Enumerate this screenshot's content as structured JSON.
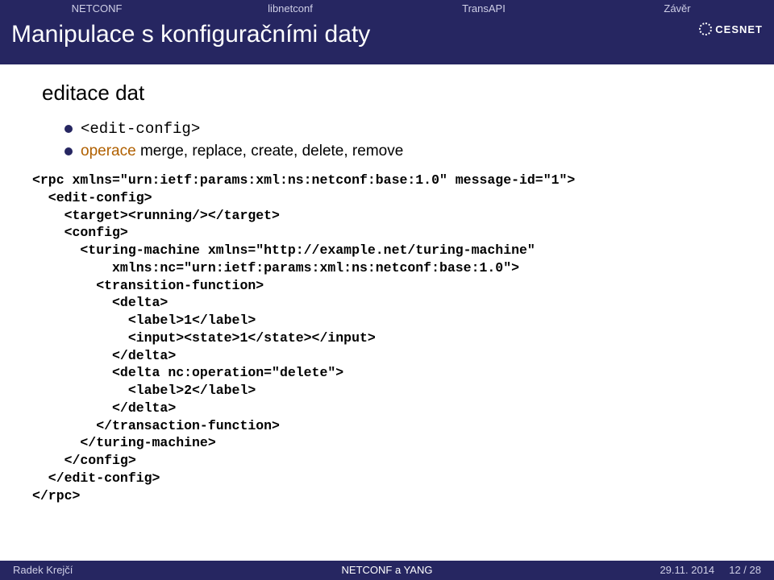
{
  "nav": [
    "NETCONF",
    "libnetconf",
    "TransAPI",
    "Závěr"
  ],
  "header": {
    "title": "Manipulace s konfiguračními daty",
    "logo": "CESNET"
  },
  "section": "editace dat",
  "bullet1": "<edit-config>",
  "bullet2_prefix": "operace",
  "bullet2_ops": " merge, replace, create, delete, remove",
  "code": "<rpc xmlns=\"urn:ietf:params:xml:ns:netconf:base:1.0\" message-id=\"1\">\n  <edit-config>\n    <target><running/></target>\n    <config>\n      <turing-machine xmlns=\"http://example.net/turing-machine\"\n          xmlns:nc=\"urn:ietf:params:xml:ns:netconf:base:1.0\">\n        <transition-function>\n          <delta>\n            <label>1</label>\n            <input><state>1</state></input>\n          </delta>\n          <delta nc:operation=\"delete\">\n            <label>2</label>\n          </delta>\n        </transaction-function>\n      </turing-machine>\n    </config>\n  </edit-config>\n</rpc>",
  "footer": {
    "author": "Radek Krejčí",
    "center": "NETCONF a YANG",
    "date": "29.11. 2014",
    "page": "12 / 28"
  }
}
